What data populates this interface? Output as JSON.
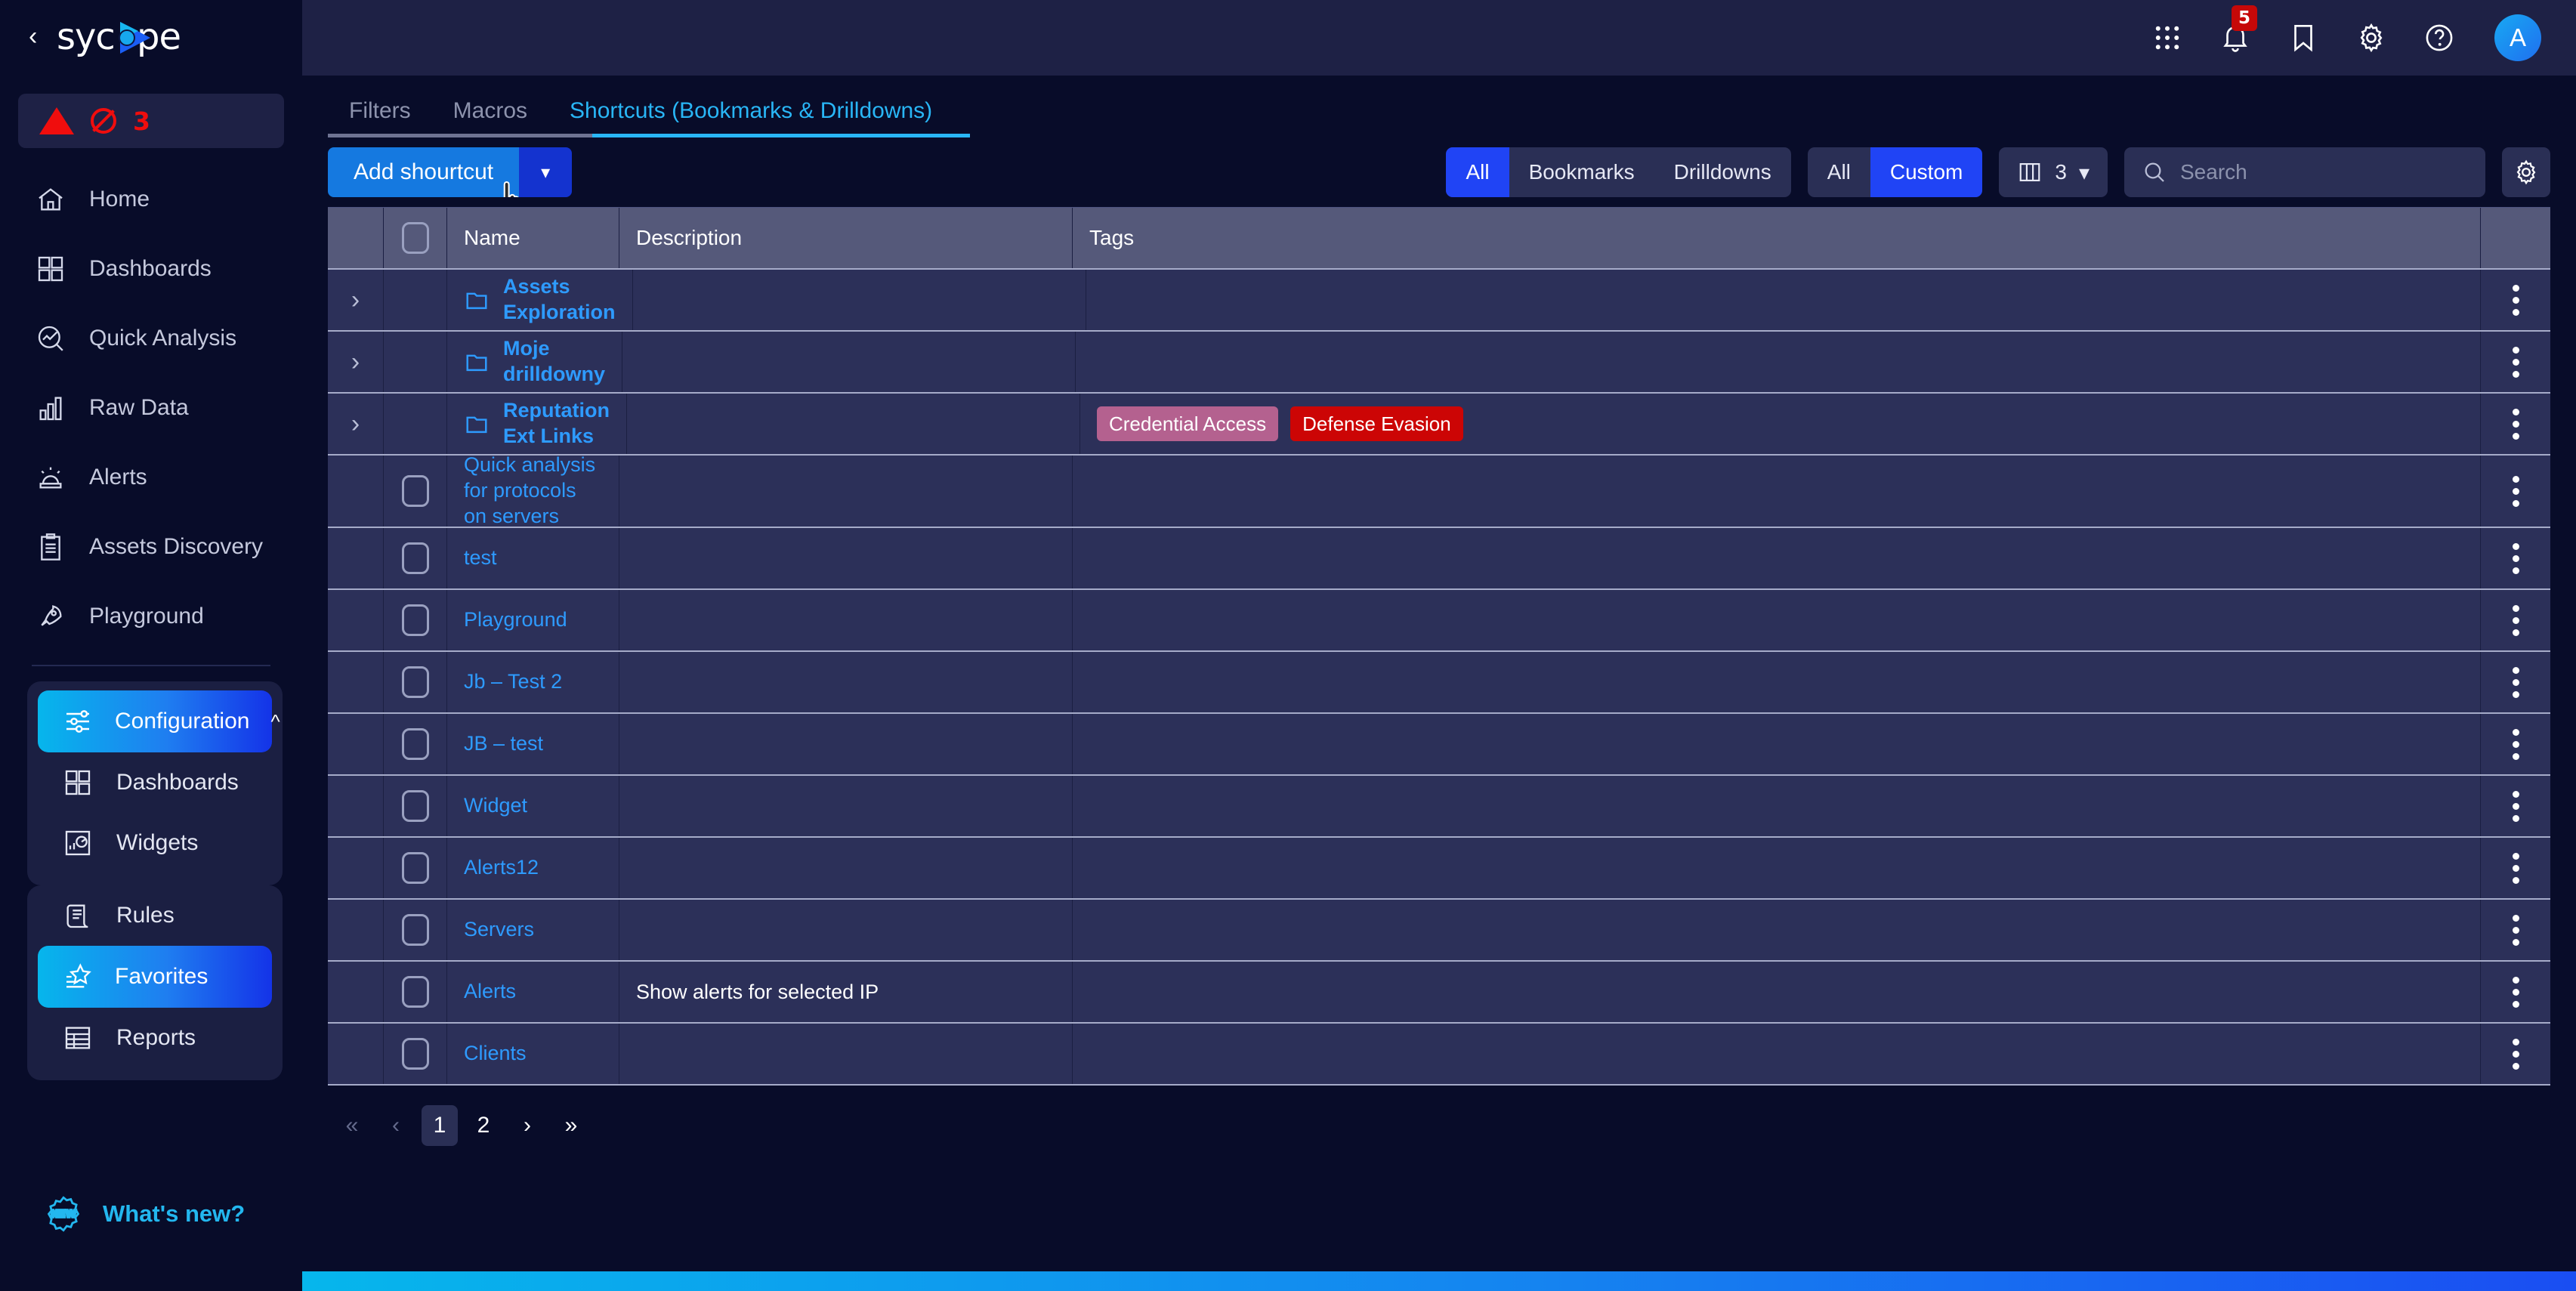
{
  "brand": {
    "name": "sycope",
    "collapse_icon": "chevron-left-icon"
  },
  "sidebar": {
    "alert_chip": {
      "count": "3",
      "warning_icon": "warning-triangle-icon",
      "blocked_icon": "no-entry-icon"
    },
    "items": [
      {
        "label": "Home",
        "icon": "home-icon"
      },
      {
        "label": "Dashboards",
        "icon": "grid-squares-icon"
      },
      {
        "label": "Quick Analysis",
        "icon": "magnifier-chart-icon"
      },
      {
        "label": "Raw Data",
        "icon": "bar-chart-icon"
      },
      {
        "label": "Alerts",
        "icon": "siren-icon"
      },
      {
        "label": "Assets Discovery",
        "icon": "clipboard-list-icon"
      },
      {
        "label": "Playground",
        "icon": "rocket-icon"
      }
    ],
    "config": {
      "label": "Configuration",
      "icon": "sliders-icon",
      "expand_icon": "chevron-up-icon",
      "children": [
        {
          "label": "Dashboards",
          "icon": "grid-squares-icon",
          "active": false
        },
        {
          "label": "Widgets",
          "icon": "widget-chart-icon",
          "active": false
        },
        {
          "label": "Rules",
          "icon": "scroll-icon",
          "active": false
        },
        {
          "label": "Favorites",
          "icon": "star-list-icon",
          "active": true
        },
        {
          "label": "Reports",
          "icon": "table-icon",
          "active": false
        }
      ]
    },
    "whats_new": {
      "label": "What's new?",
      "icon": "new-badge-icon"
    }
  },
  "topbar": {
    "icons": [
      {
        "name": "apps-grid-icon",
        "badge": ""
      },
      {
        "name": "bell-icon",
        "badge": "5"
      },
      {
        "name": "bookmark-icon",
        "badge": ""
      },
      {
        "name": "gear-icon",
        "badge": ""
      },
      {
        "name": "help-circle-icon",
        "badge": ""
      }
    ],
    "avatar": "A"
  },
  "tabs": [
    {
      "label": "Filters",
      "active": false
    },
    {
      "label": "Macros",
      "active": false
    },
    {
      "label": "Shortcuts (Bookmarks & Drilldowns)",
      "active": true
    }
  ],
  "toolbar": {
    "add_button": {
      "label": "Add shourtcut",
      "caret_icon": "chevron-down-icon"
    },
    "type_filter": {
      "options": [
        "All",
        "Bookmarks",
        "Drilldowns"
      ],
      "selected": "All"
    },
    "scope_filter": {
      "options": [
        "All",
        "Custom"
      ],
      "selected": "Custom"
    },
    "columns": {
      "icon": "columns-icon",
      "value": "3",
      "caret_icon": "chevron-down-icon"
    },
    "search": {
      "icon": "search-icon",
      "value": "",
      "placeholder": "Search"
    },
    "settings_button": {
      "icon": "gear-icon"
    }
  },
  "table": {
    "columns": [
      "",
      "",
      "Name",
      "Description",
      "Tags",
      ""
    ],
    "headers": {
      "name": "Name",
      "description": "Description",
      "tags": "Tags"
    },
    "rows": [
      {
        "kind": "folder",
        "name": "Assets Exploration",
        "description": "",
        "tags": [],
        "expand_icon": "chevron-right-icon",
        "row_icon": "folder-icon"
      },
      {
        "kind": "folder",
        "name": "Moje drilldowny",
        "description": "",
        "tags": [],
        "expand_icon": "chevron-right-icon",
        "row_icon": "folder-icon"
      },
      {
        "kind": "folder",
        "name": "Reputation Ext Links",
        "description": "",
        "expand_icon": "chevron-right-icon",
        "row_icon": "folder-icon",
        "tags": [
          {
            "label": "Credential Access",
            "color": "#b4618f"
          },
          {
            "label": "Defense Evasion",
            "color": "#cc0505"
          }
        ]
      },
      {
        "kind": "item",
        "name": "Quick analysis for protocols on servers",
        "description": "",
        "tags": []
      },
      {
        "kind": "item",
        "name": "test",
        "description": "",
        "tags": []
      },
      {
        "kind": "item",
        "name": "Playground",
        "description": "",
        "tags": []
      },
      {
        "kind": "item",
        "name": "Jb – Test 2",
        "description": "",
        "tags": []
      },
      {
        "kind": "item",
        "name": "JB – test",
        "description": "",
        "tags": []
      },
      {
        "kind": "item",
        "name": "Widget",
        "description": "",
        "tags": []
      },
      {
        "kind": "item",
        "name": "Alerts12",
        "description": "",
        "tags": []
      },
      {
        "kind": "item",
        "name": "Servers",
        "description": "",
        "tags": []
      },
      {
        "kind": "item",
        "name": "Alerts",
        "description": "Show alerts for selected IP",
        "tags": []
      },
      {
        "kind": "item",
        "name": "Clients",
        "description": "",
        "tags": []
      }
    ],
    "row_menu_icon": "vertical-dots-icon"
  },
  "pagination": {
    "first": "«",
    "prev": "‹",
    "next": "›",
    "last": "»",
    "pages": [
      "1",
      "2"
    ],
    "current": "1"
  },
  "colors": {
    "accent": "#29b6f6",
    "primary": "#2044f5",
    "link": "#2e9bff",
    "danger": "#c60808"
  }
}
